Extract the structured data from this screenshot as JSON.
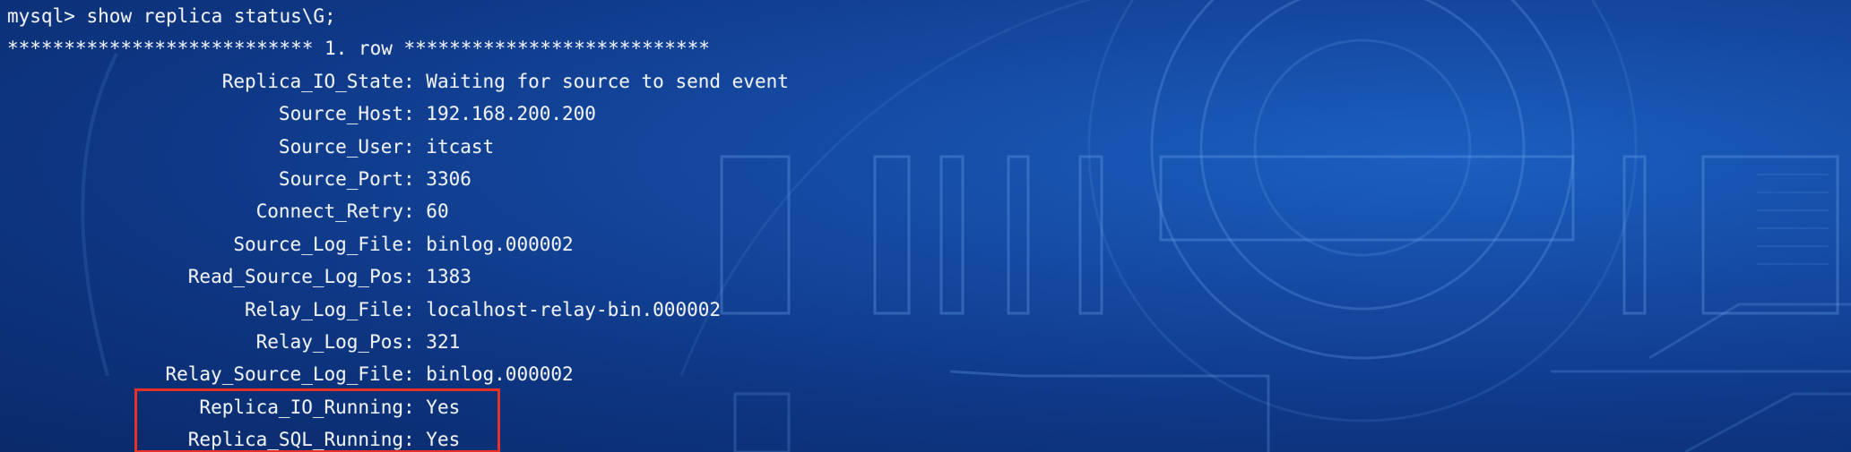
{
  "terminal": {
    "prompt": "mysql>",
    "command": "show replica status\\G;",
    "row_header": "*************************** 1. row ***************************",
    "fields": [
      {
        "key": "Replica_IO_State",
        "value": "Waiting for source to send event"
      },
      {
        "key": "Source_Host",
        "value": "192.168.200.200"
      },
      {
        "key": "Source_User",
        "value": "itcast"
      },
      {
        "key": "Source_Port",
        "value": "3306"
      },
      {
        "key": "Connect_Retry",
        "value": "60"
      },
      {
        "key": "Source_Log_File",
        "value": "binlog.000002"
      },
      {
        "key": "Read_Source_Log_Pos",
        "value": "1383"
      },
      {
        "key": "Relay_Log_File",
        "value": "localhost-relay-bin.000002"
      },
      {
        "key": "Relay_Log_Pos",
        "value": "321"
      },
      {
        "key": "Relay_Source_Log_File",
        "value": "binlog.000002"
      },
      {
        "key": "Replica_IO_Running",
        "value": "Yes"
      },
      {
        "key": "Replica_SQL_Running",
        "value": "Yes"
      }
    ],
    "separator": ": "
  },
  "highlight": {
    "color": "#e63028",
    "target_keys": [
      "Replica_IO_Running",
      "Replica_SQL_Running"
    ]
  },
  "theme": {
    "background": "#1448a0",
    "text": "#eef2f8"
  }
}
